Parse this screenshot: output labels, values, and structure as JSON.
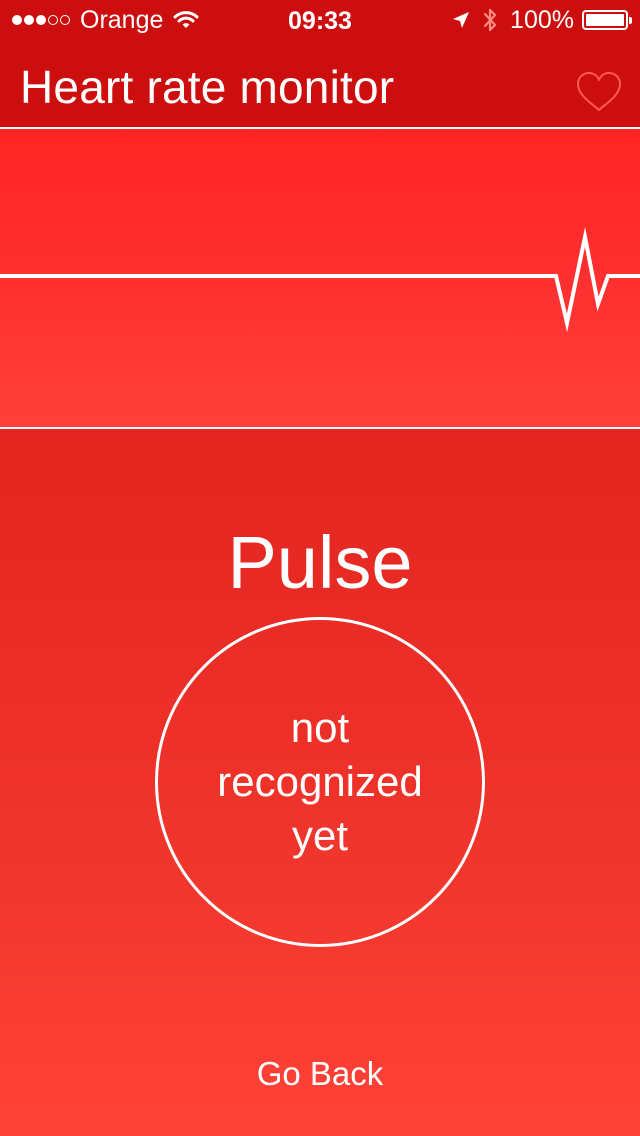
{
  "status_bar": {
    "signal_dots_filled": 3,
    "signal_dots_total": 5,
    "carrier": "Orange",
    "time": "09:33",
    "battery_percent": "100%",
    "icons": [
      "wifi-icon",
      "location-arrow-icon",
      "bluetooth-icon",
      "battery-icon"
    ]
  },
  "nav": {
    "title": "Heart rate monitor",
    "heart_icon": "heart-outline-icon"
  },
  "pulse": {
    "title": "Pulse",
    "status": "not recognized yet"
  },
  "actions": {
    "go_back": "Go Back"
  },
  "colors": {
    "bar_background": "#cc0e0e",
    "graph_background": "#ff2c28",
    "body_top": "#d81c1c",
    "body_bottom": "#ff4237",
    "foreground": "#ffffff"
  }
}
